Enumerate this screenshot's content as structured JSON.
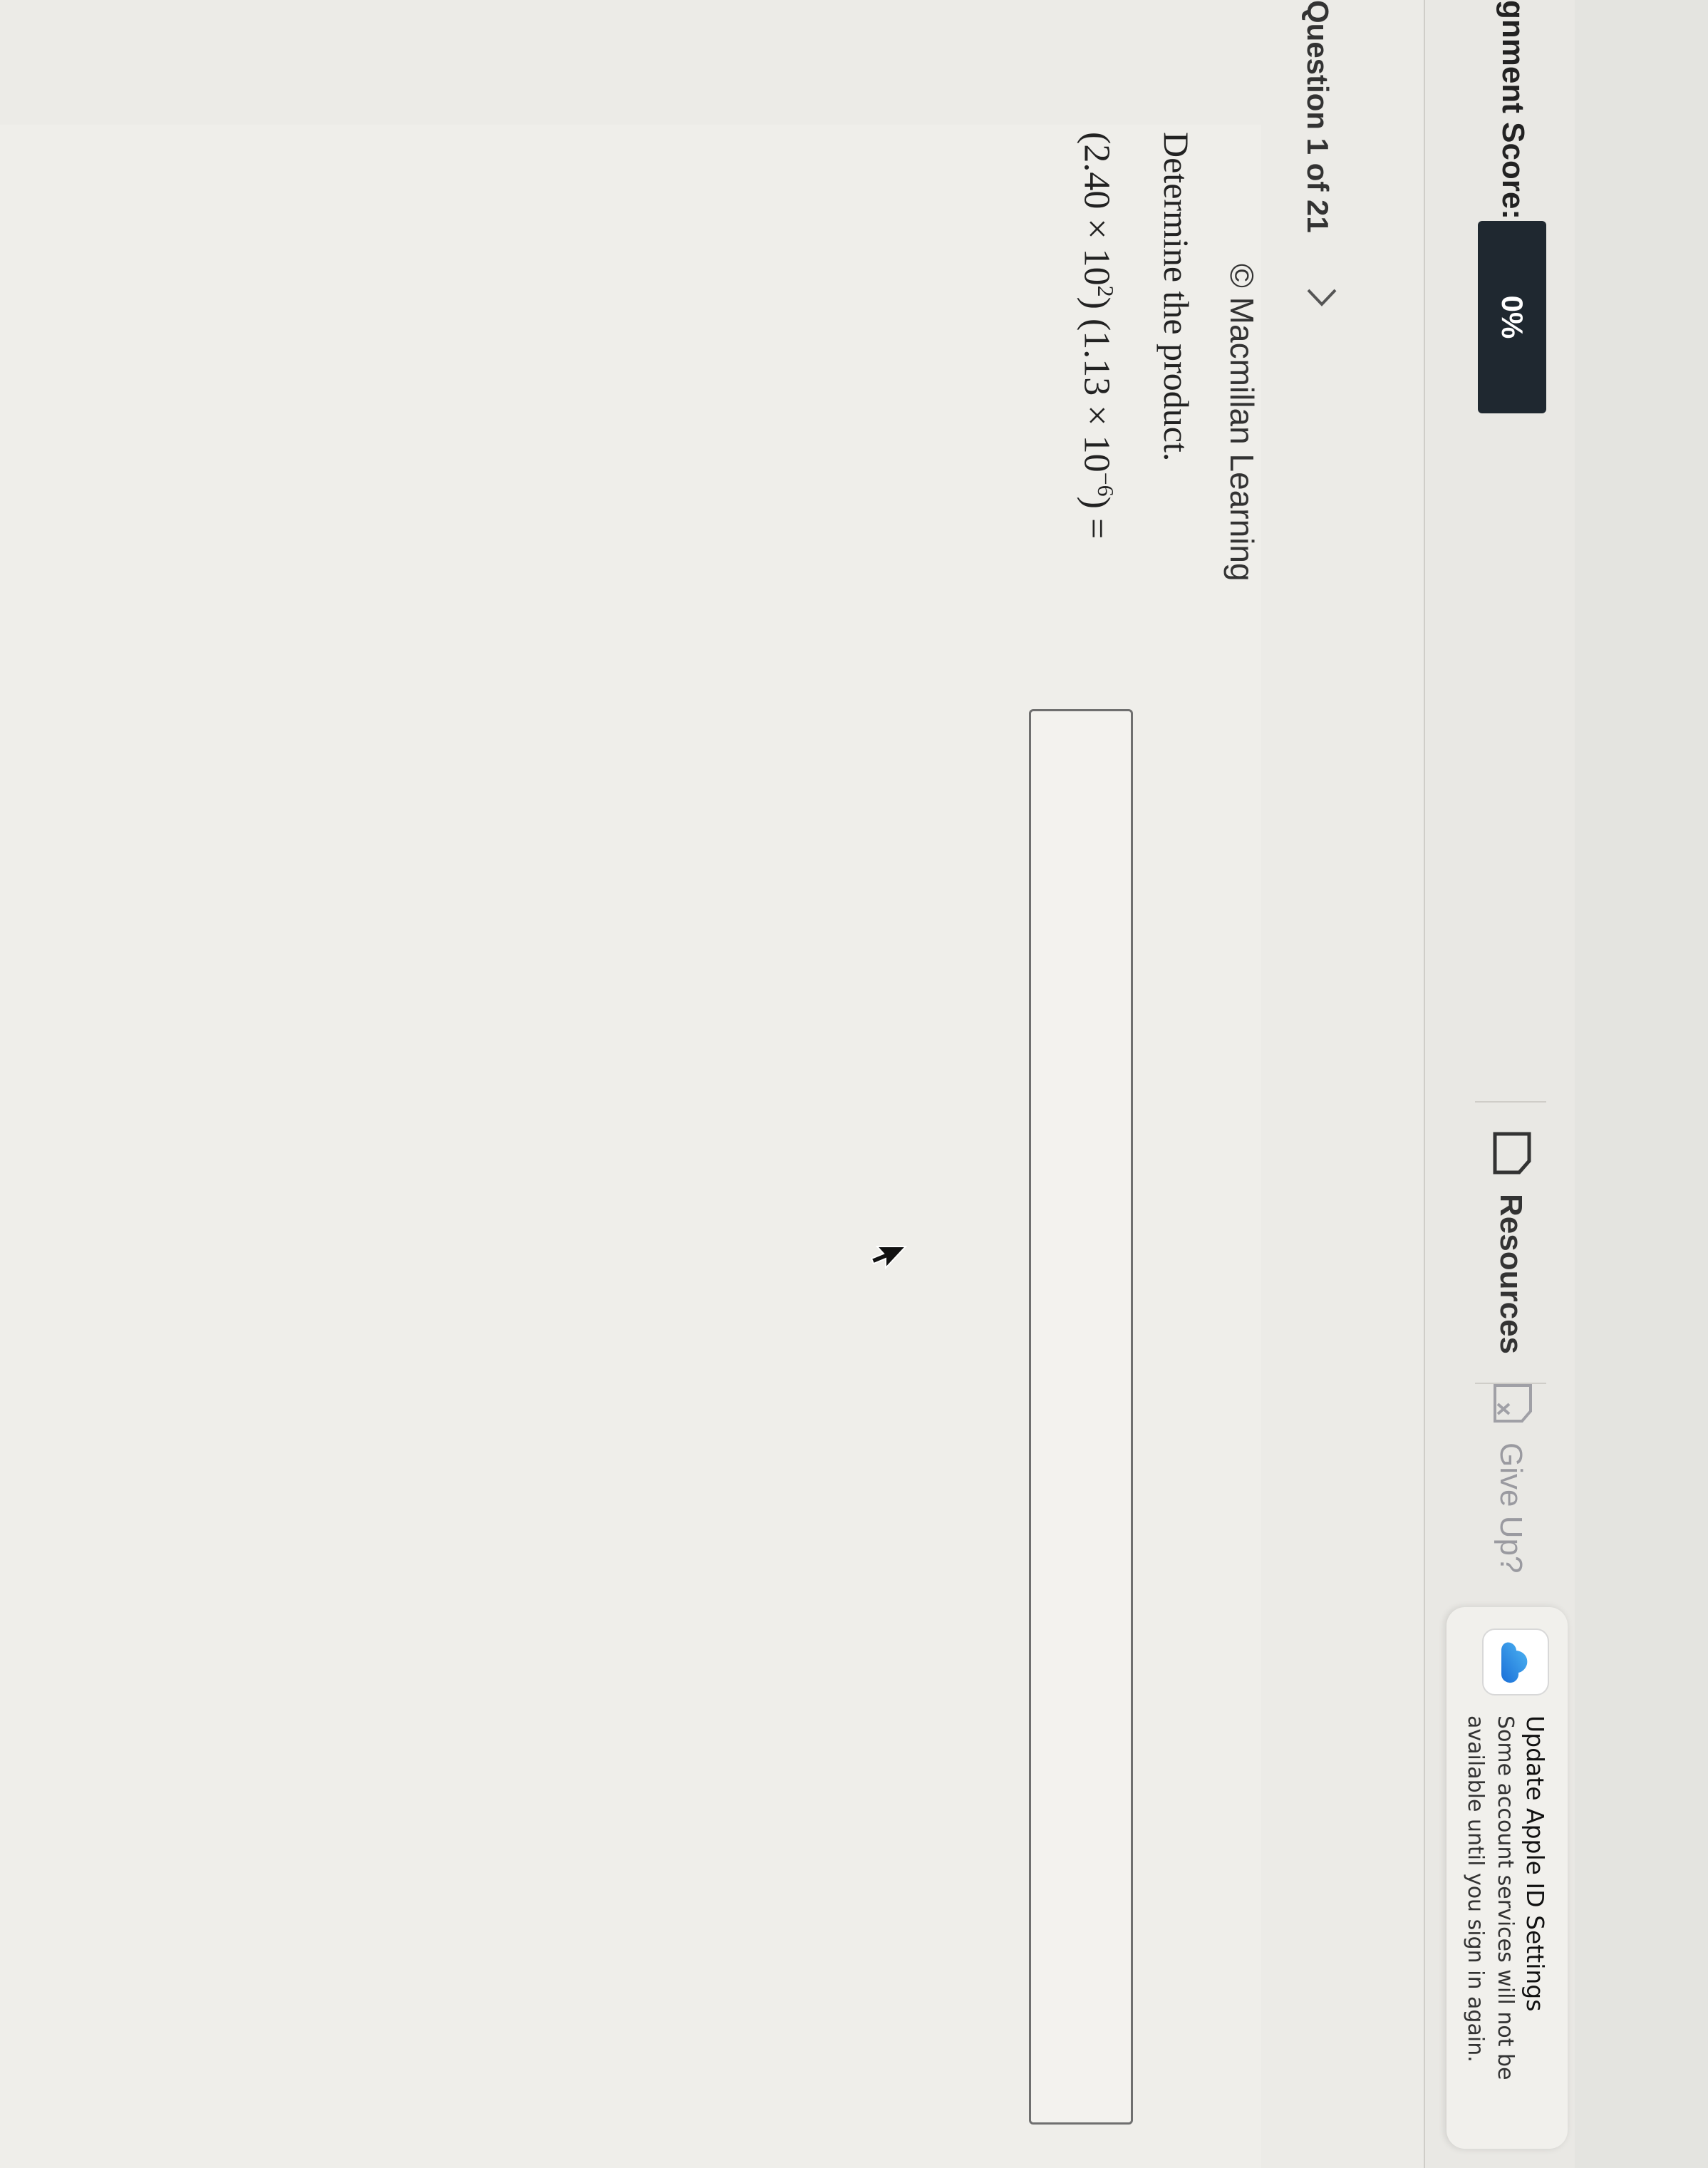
{
  "header": {
    "score_label": "gnment Score:",
    "score_value": "0%",
    "resources_label": "Resources",
    "giveup_label": "Give Up?"
  },
  "notification": {
    "title": "Update Apple ID Settings",
    "body_line1": "Some account services will not be",
    "body_line2": "available until you sign in again."
  },
  "question_nav": {
    "label": "Question 1 of 21"
  },
  "question": {
    "copyright": "© Macmillan Learning",
    "prompt": "Determine the product.",
    "expression": {
      "open1": "(2.40 × 10",
      "exp1": "2",
      "mid": ") (1.13 × 10",
      "exp2": "−6",
      "close": ") ="
    },
    "answer_value": ""
  },
  "colors": {
    "score_badge": "#1f2830",
    "background": "#ecebe7",
    "bezel": "#1a1a1a"
  }
}
